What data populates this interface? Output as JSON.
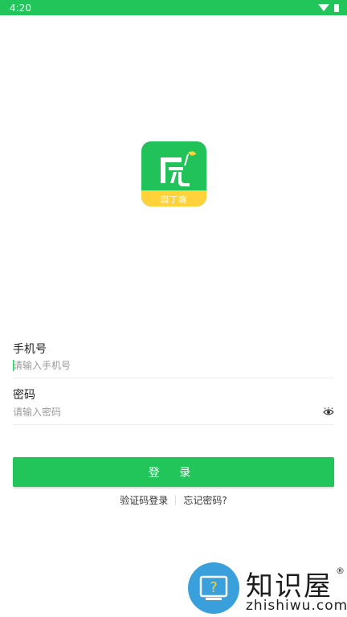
{
  "status_bar": {
    "time": "4:20",
    "wifi_icon": "wifi-icon",
    "battery_icon": "battery-icon"
  },
  "logo": {
    "badge_text": "园丁端",
    "icon": "leaf-sprout-icon",
    "colors": {
      "green": "#21c25a",
      "yellow": "#ffd23a"
    }
  },
  "form": {
    "phone": {
      "label": "手机号",
      "placeholder": "请输入手机号",
      "value": ""
    },
    "password": {
      "label": "密码",
      "placeholder": "请输入密码",
      "value": "",
      "toggle_icon": "eye-icon"
    }
  },
  "login_button": {
    "label": "登 录"
  },
  "links": {
    "sms_login": "验证码登录",
    "forgot_password": "忘记密码?"
  },
  "watermark": {
    "title": "知识屋",
    "url": "zhishiwu.com",
    "reg": "®",
    "icon": "question-monitor-icon"
  },
  "theme": {
    "accent": "#22c55a"
  }
}
